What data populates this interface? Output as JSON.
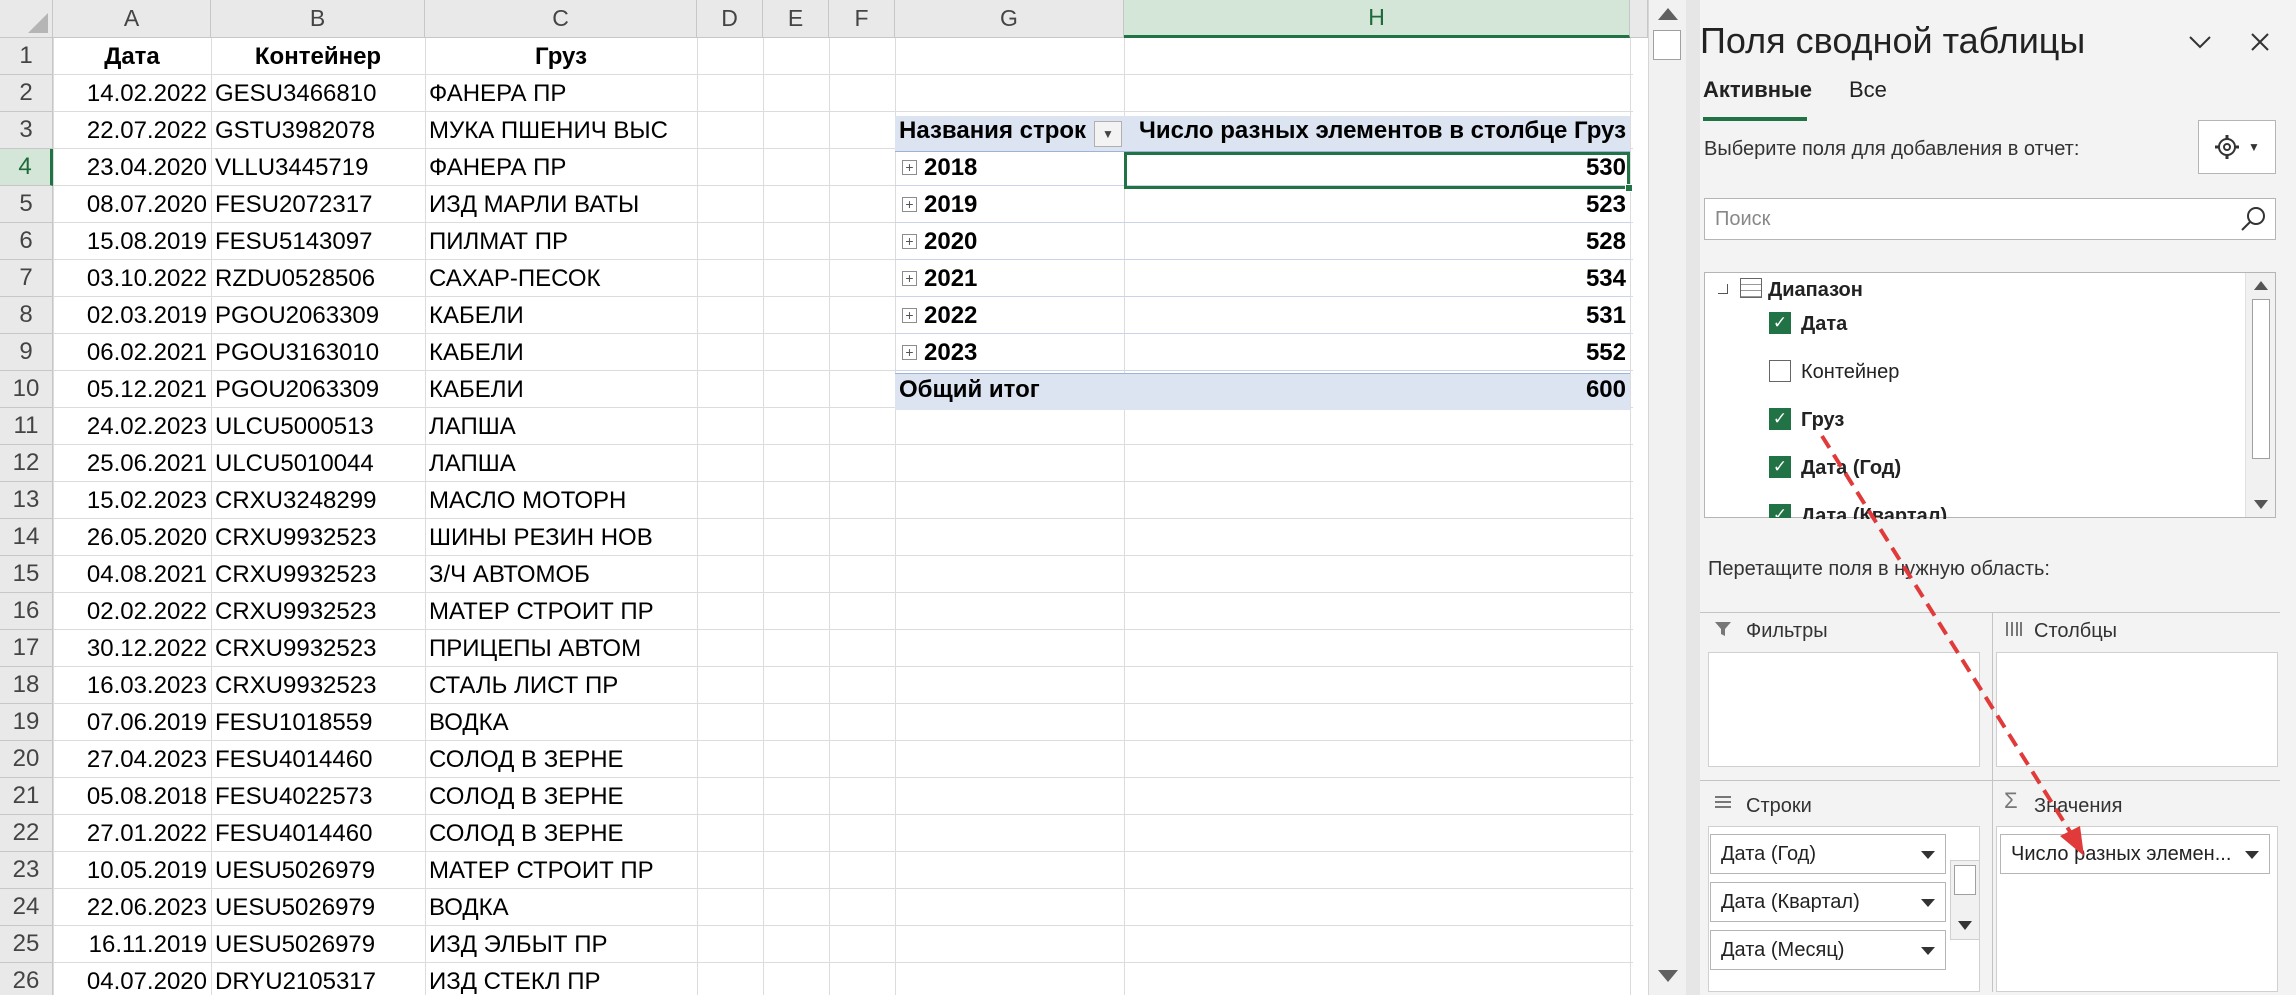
{
  "columns": [
    "A",
    "B",
    "C",
    "D",
    "E",
    "F",
    "G",
    "H"
  ],
  "header_row": [
    "Дата",
    "Контейнер",
    "Груз"
  ],
  "rows": [
    [
      "14.02.2022",
      "GESU3466810",
      "ФАНЕРА ПР"
    ],
    [
      "22.07.2022",
      "GSTU3982078",
      "МУКА ПШЕНИЧ ВЫС"
    ],
    [
      "23.04.2020",
      "VLLU3445719",
      "ФАНЕРА ПР"
    ],
    [
      "08.07.2020",
      "FESU2072317",
      "ИЗД МАРЛИ ВАТЫ"
    ],
    [
      "15.08.2019",
      "FESU5143097",
      "ПИЛМАТ ПР"
    ],
    [
      "03.10.2022",
      "RZDU0528506",
      "САХАР-ПЕСОК"
    ],
    [
      "02.03.2019",
      "PGOU2063309",
      "КАБЕЛИ"
    ],
    [
      "06.02.2021",
      "PGOU3163010",
      "КАБЕЛИ"
    ],
    [
      "05.12.2021",
      "PGOU2063309",
      "КАБЕЛИ"
    ],
    [
      "24.02.2023",
      "ULCU5000513",
      "ЛАПША"
    ],
    [
      "25.06.2021",
      "ULCU5010044",
      "ЛАПША"
    ],
    [
      "15.02.2023",
      "CRXU3248299",
      "МАСЛО МОТОРН"
    ],
    [
      "26.05.2020",
      "CRXU9932523",
      "ШИНЫ РЕЗИН НОВ"
    ],
    [
      "04.08.2021",
      "CRXU9932523",
      "З/Ч АВТОМОБ"
    ],
    [
      "02.02.2022",
      "CRXU9932523",
      "МАТЕР СТРОИТ ПР"
    ],
    [
      "30.12.2022",
      "CRXU9932523",
      "ПРИЦЕПЫ АВТОМ"
    ],
    [
      "16.03.2023",
      "CRXU9932523",
      "СТАЛЬ ЛИСТ ПР"
    ],
    [
      "07.06.2019",
      "FESU1018559",
      "ВОДКА"
    ],
    [
      "27.04.2023",
      "FESU4014460",
      "СОЛОД В ЗЕРНЕ"
    ],
    [
      "05.08.2018",
      "FESU4022573",
      "СОЛОД В ЗЕРНЕ"
    ],
    [
      "27.01.2022",
      "FESU4014460",
      "СОЛОД В ЗЕРНЕ"
    ],
    [
      "10.05.2019",
      "UESU5026979",
      "МАТЕР СТРОИТ ПР"
    ],
    [
      "22.06.2023",
      "UESU5026979",
      "ВОДКА"
    ],
    [
      "16.11.2019",
      "UESU5026979",
      "ИЗД ЭЛБЫТ ПР"
    ],
    [
      "04.07.2020",
      "DRYU2105317",
      "ИЗД СТЕКЛ ПР"
    ]
  ],
  "row_numbers": [
    "1",
    "2",
    "3",
    "4",
    "5",
    "6",
    "7",
    "8",
    "9",
    "10",
    "11",
    "12",
    "13",
    "14",
    "15",
    "16",
    "17",
    "18",
    "19",
    "20",
    "21",
    "22",
    "23",
    "24",
    "25",
    "26"
  ],
  "pivot": {
    "row_label_header": "Названия строк",
    "value_header": "Число разных элементов в столбце Груз",
    "rows": [
      {
        "label": "2018",
        "value": "530"
      },
      {
        "label": "2019",
        "value": "523"
      },
      {
        "label": "2020",
        "value": "528"
      },
      {
        "label": "2021",
        "value": "534"
      },
      {
        "label": "2022",
        "value": "531"
      },
      {
        "label": "2023",
        "value": "552"
      }
    ],
    "total_label": "Общий итог",
    "total_value": "600"
  },
  "pane": {
    "title": "Поля сводной таблицы",
    "tab_active": "Активные",
    "tab_all": "Все",
    "choose_fields": "Выберите поля для добавления в отчет:",
    "search_placeholder": "Поиск",
    "table_name": "Диапазон",
    "fields": [
      {
        "name": "Дата",
        "checked": true
      },
      {
        "name": "Контейнер",
        "checked": false
      },
      {
        "name": "Груз",
        "checked": true
      },
      {
        "name": "Дата (Год)",
        "checked": true
      },
      {
        "name": "Дата (Квартал)",
        "checked": true
      }
    ],
    "drag_hint": "Перетащите поля в нужную область:",
    "filters": "Фильтры",
    "columns": "Столбцы",
    "rows_area": "Строки",
    "values_area": "Значения",
    "row_fields": [
      "Дата (Год)",
      "Дата (Квартал)",
      "Дата (Месяц)"
    ],
    "value_fields": [
      "Число разных элемен..."
    ]
  },
  "colors": {
    "accent": "#217346",
    "pivot_header": "#dce4f2",
    "annotation_arrow": "#e03a3a"
  }
}
